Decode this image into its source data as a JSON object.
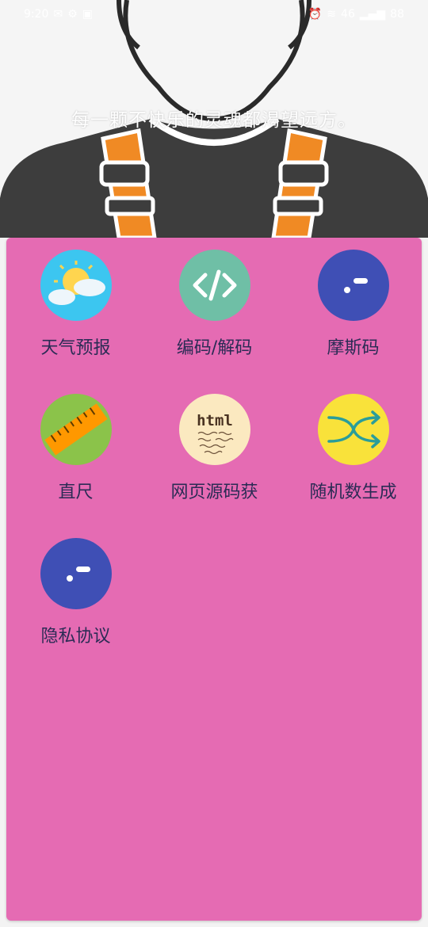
{
  "status_bar": {
    "time": "9:20",
    "left_icons": [
      "notification-icon",
      "settings-icon",
      "message-icon"
    ],
    "right_text": "46",
    "battery": "88"
  },
  "header": {
    "slogan": "每一颗不快乐的灵魂都渴望远方。"
  },
  "colors": {
    "panel": "#e56bb3",
    "label": "#2b2b55",
    "harness": "#f08a24",
    "shirt": "#3d3d3d"
  },
  "tools": [
    {
      "label": "天气预报",
      "icon": "weather-icon",
      "bg": "#3cc6f0"
    },
    {
      "label": "编码/解码",
      "icon": "code-icon",
      "bg": "#6fbfa6"
    },
    {
      "label": "摩斯码",
      "icon": "morse-icon",
      "bg": "#3f4fb5"
    },
    {
      "label": "直尺",
      "icon": "ruler-icon",
      "bg": "#8bc34a"
    },
    {
      "label": "网页源码获",
      "icon": "html-icon",
      "bg": "#fbe9c0"
    },
    {
      "label": "随机数生成",
      "icon": "shuffle-icon",
      "bg": "#f9e23a"
    },
    {
      "label": "隐私协议",
      "icon": "privacy-icon",
      "bg": "#3f4fb5"
    }
  ]
}
